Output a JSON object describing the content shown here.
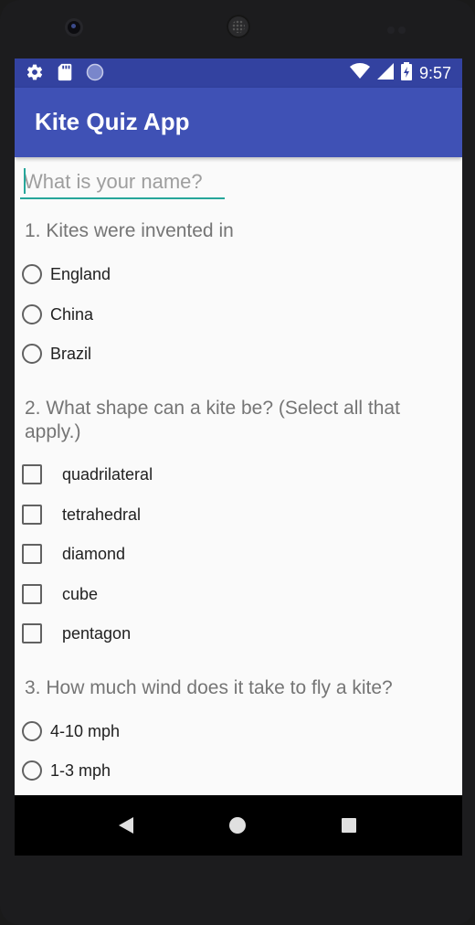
{
  "status_bar": {
    "time": "9:57",
    "left_icons": [
      "gear-icon",
      "sd-card-icon",
      "circle-icon"
    ],
    "right_icons": [
      "wifi-icon",
      "signal-icon",
      "battery-icon"
    ]
  },
  "app_bar": {
    "title": "Kite Quiz App"
  },
  "name_field": {
    "placeholder": "What is your name?",
    "value": ""
  },
  "questions": [
    {
      "text": "1. Kites were invented in",
      "type": "radio",
      "options": [
        "England",
        "China",
        "Brazil"
      ]
    },
    {
      "text": "2. What shape can a kite be? (Select all that apply.)",
      "type": "checkbox",
      "options": [
        "quadrilateral",
        "tetrahedral",
        "diamond",
        "cube",
        "pentagon"
      ]
    },
    {
      "text": "3. How much wind does it take to fly a kite?",
      "type": "radio",
      "options": [
        "4-10 mph",
        "1-3 mph"
      ]
    }
  ],
  "nav_bar": {
    "buttons": [
      "back-icon",
      "home-icon",
      "recents-icon"
    ]
  },
  "colors": {
    "primary": "#3f51b5",
    "primary_dark": "#3342a0",
    "accent": "#26a69a"
  }
}
